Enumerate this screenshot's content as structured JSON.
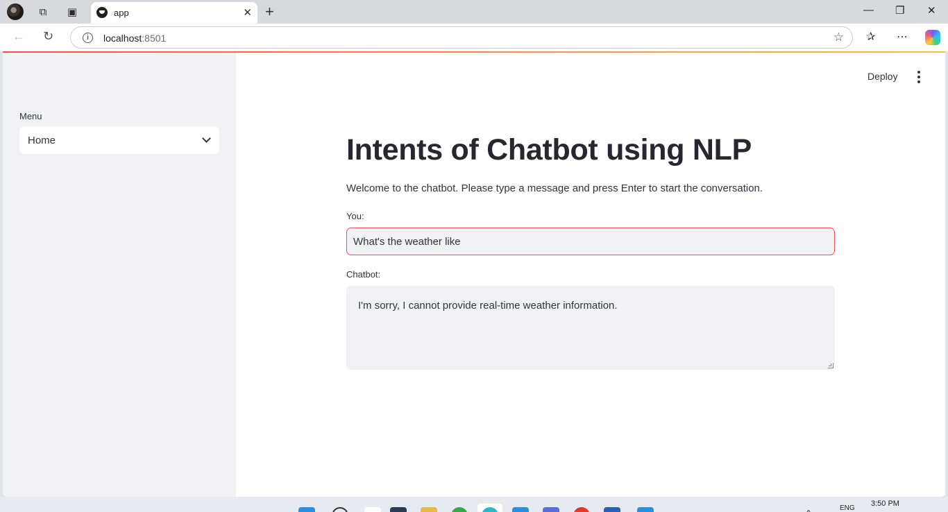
{
  "browser": {
    "tab_title": "app",
    "url_host": "localhost",
    "url_port": ":8501"
  },
  "sidebar": {
    "menu_label": "Menu",
    "menu_selected": "Home"
  },
  "header": {
    "deploy_label": "Deploy"
  },
  "main": {
    "title": "Intents of Chatbot using NLP",
    "welcome": "Welcome to the chatbot. Please type a message and press Enter to start the conversation.",
    "you_label": "You:",
    "you_value": "What's the weather like",
    "chatbot_label": "Chatbot:",
    "chatbot_response": "I'm sorry, I cannot provide real-time weather information."
  },
  "taskbar": {
    "time": "3:50 PM",
    "language": "ENG"
  },
  "colors": {
    "accent": "#ff4b4b",
    "sidebar_bg": "#f0f2f6",
    "text": "#31333f"
  }
}
